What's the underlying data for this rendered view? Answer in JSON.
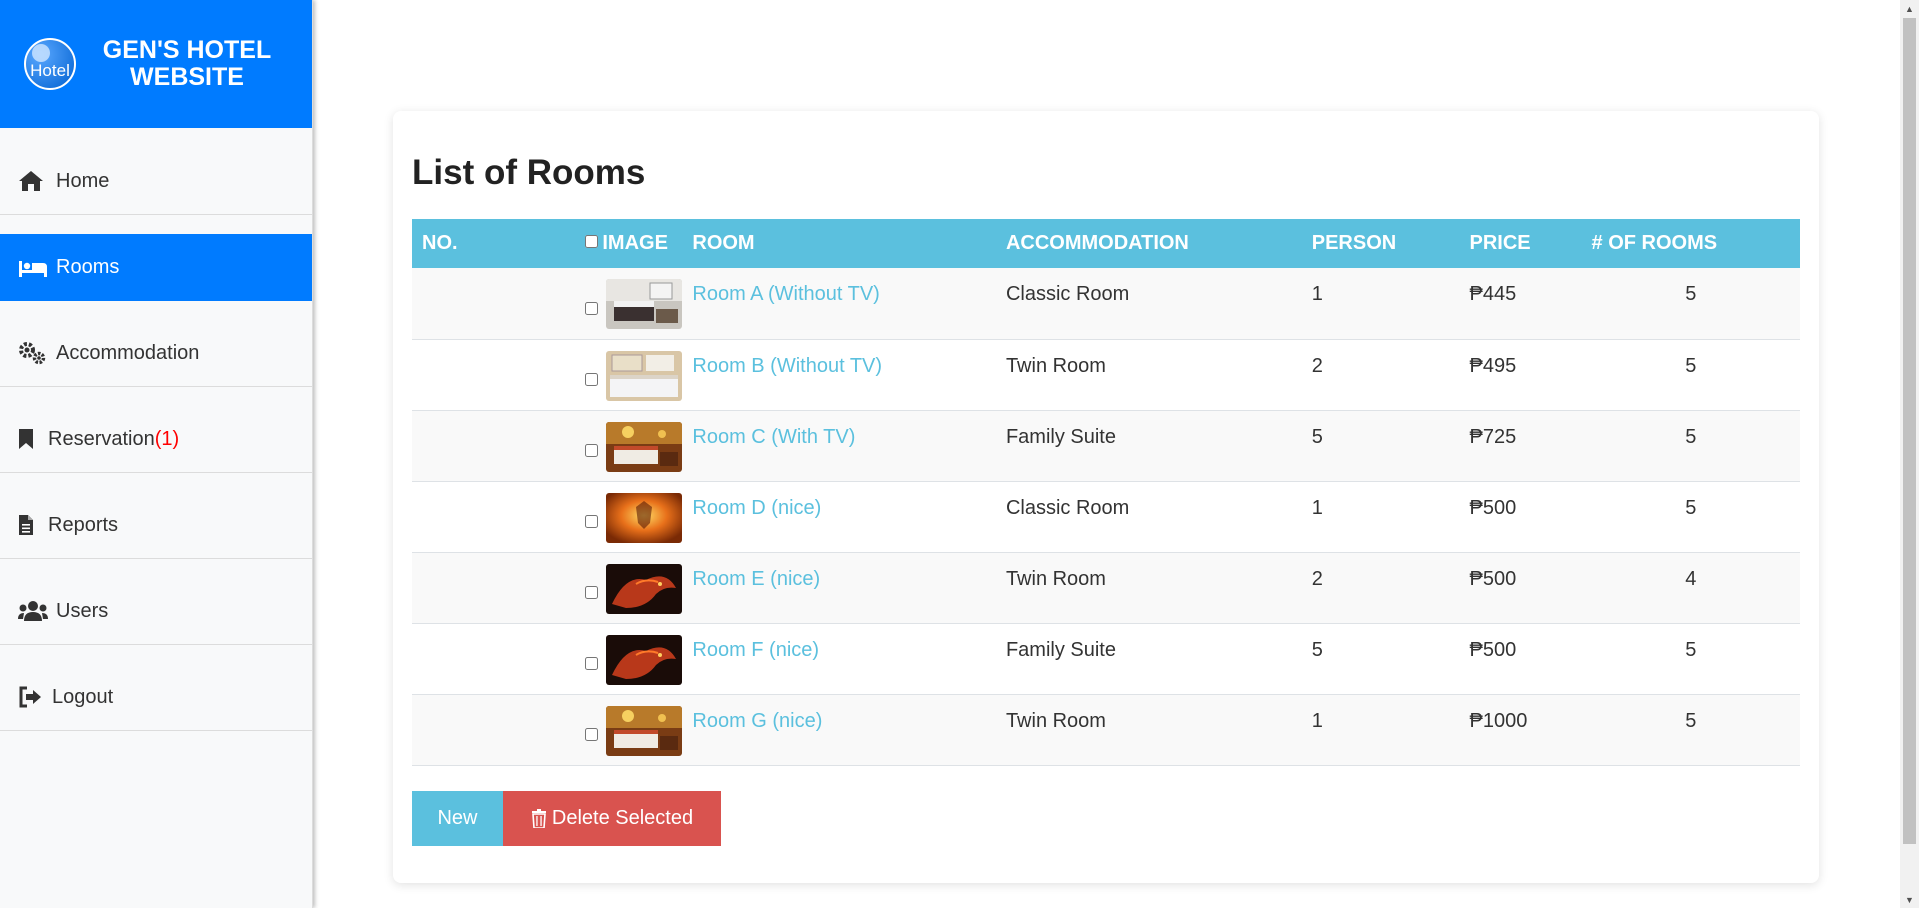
{
  "brand": {
    "logo_text": "Hotel",
    "title": "GEN'S HOTEL WEBSITE"
  },
  "sidebar": {
    "items": [
      {
        "label": "Home",
        "icon": "home-icon"
      },
      {
        "label": "Rooms",
        "icon": "bed-icon",
        "active": true
      },
      {
        "label": "Accommodation",
        "icon": "gears-icon"
      },
      {
        "label": "Reservation",
        "badge": "(1)",
        "icon": "bookmark-icon"
      },
      {
        "label": "Reports",
        "icon": "file-icon"
      },
      {
        "label": "Users",
        "icon": "users-icon"
      },
      {
        "label": "Logout",
        "icon": "sign-out-icon"
      }
    ]
  },
  "main": {
    "title": "List of Rooms",
    "columns": [
      "NO.",
      "IMAGE",
      "ROOM",
      "ACCOMMODATION",
      "PERSON",
      "PRICE",
      "# OF ROOMS"
    ],
    "rows": [
      {
        "no": "",
        "room": "Room A (Without TV)",
        "accommodation": "Classic Room",
        "person": "1",
        "price": "₱445",
        "rooms": "5",
        "thumb": "bedroom-grey"
      },
      {
        "no": "",
        "room": "Room B (Without TV)",
        "accommodation": "Twin Room",
        "person": "2",
        "price": "₱495",
        "rooms": "5",
        "thumb": "bedroom-beige"
      },
      {
        "no": "",
        "room": "Room C (With TV)",
        "accommodation": "Family Suite",
        "person": "5",
        "price": "₱725",
        "rooms": "5",
        "thumb": "bedroom-warm"
      },
      {
        "no": "",
        "room": "Room D (nice)",
        "accommodation": "Classic Room",
        "person": "1",
        "price": "₱500",
        "rooms": "5",
        "thumb": "fire"
      },
      {
        "no": "",
        "room": "Room E (nice)",
        "accommodation": "Twin Room",
        "person": "2",
        "price": "₱500",
        "rooms": "4",
        "thumb": "dragon"
      },
      {
        "no": "",
        "room": "Room F (nice)",
        "accommodation": "Family Suite",
        "person": "5",
        "price": "₱500",
        "rooms": "5",
        "thumb": "dragon"
      },
      {
        "no": "",
        "room": "Room G (nice)",
        "accommodation": "Twin Room",
        "person": "1",
        "price": "₱1000",
        "rooms": "5",
        "thumb": "bedroom-warm"
      }
    ],
    "buttons": {
      "new": "New",
      "delete": "Delete Selected"
    }
  },
  "colors": {
    "primary": "#007bff",
    "info": "#5bc0de",
    "danger": "#d9534f",
    "badge": "#ff0000"
  }
}
